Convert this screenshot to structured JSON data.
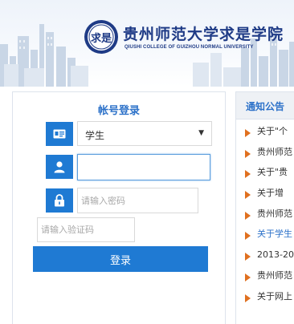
{
  "banner": {
    "college_name_cn": "贵州师范大学求是学院",
    "college_name_en": "QIUSHI COLLEGE OF GUIZHOU NORMAL UNIVERSITY",
    "seal_text": "求是"
  },
  "login": {
    "title": "帐号登录",
    "role_select": {
      "value": "学生",
      "caret": "▼"
    },
    "username": {
      "value": "",
      "placeholder": ""
    },
    "password": {
      "value": "",
      "placeholder": "请输入密码"
    },
    "captcha": {
      "value": "",
      "placeholder": "请输入验证码"
    },
    "submit_label": "登录"
  },
  "notices": {
    "title": "通知公告",
    "items": [
      {
        "text": "关于\"个",
        "highlight": false
      },
      {
        "text": "贵州师范",
        "highlight": false
      },
      {
        "text": "关于\"贵",
        "highlight": false
      },
      {
        "text": "关于增",
        "highlight": false
      },
      {
        "text": "贵州师范",
        "highlight": false
      },
      {
        "text": "关于学生",
        "highlight": true
      },
      {
        "text": "2013-20",
        "highlight": false
      },
      {
        "text": "贵州师范",
        "highlight": false
      },
      {
        "text": "关于网上",
        "highlight": false
      }
    ]
  },
  "colors": {
    "accent": "#1f7ad3",
    "title_blue": "#2d72c9",
    "bullet_orange": "#e0701f",
    "brand_navy": "#1f3b86"
  }
}
